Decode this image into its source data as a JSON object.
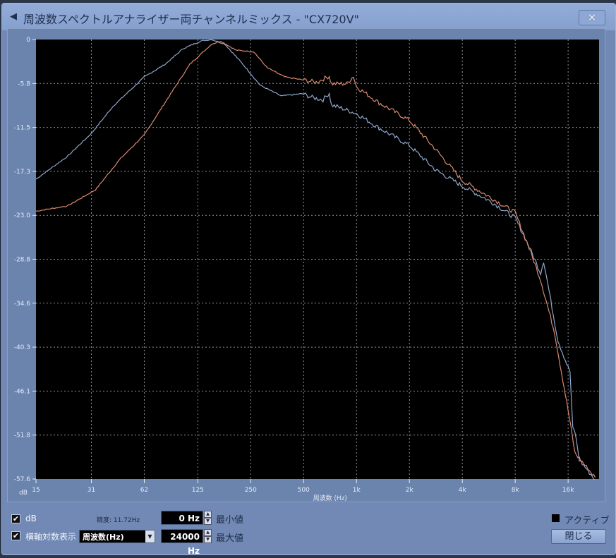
{
  "window": {
    "title": "周波数スペクトルアナライザー両チャンネルミックス - \"CX720V\"",
    "close_icon": "close-icon",
    "app_icon": "cubase-icon"
  },
  "chart_data": {
    "type": "line",
    "title": "",
    "xlabel": "周波数 (Hz)",
    "ylabel": "dB",
    "xscale": "log",
    "xlim": [
      15,
      24000
    ],
    "ylim": [
      -57.6,
      0
    ],
    "xticks": [
      {
        "v": 15,
        "label": "15"
      },
      {
        "v": 31,
        "label": "31"
      },
      {
        "v": 62,
        "label": "62"
      },
      {
        "v": 125,
        "label": "125"
      },
      {
        "v": 250,
        "label": "250"
      },
      {
        "v": 500,
        "label": "500"
      },
      {
        "v": 1000,
        "label": "1k"
      },
      {
        "v": 2000,
        "label": "2k"
      },
      {
        "v": 4000,
        "label": "4k"
      },
      {
        "v": 8000,
        "label": "8k"
      },
      {
        "v": 16000,
        "label": "16k"
      }
    ],
    "yticks": [
      {
        "v": 0,
        "label": "0"
      },
      {
        "v": -5.76,
        "label": "-5.8"
      },
      {
        "v": -11.52,
        "label": "-11.5"
      },
      {
        "v": -17.28,
        "label": "-17.3"
      },
      {
        "v": -23.04,
        "label": "-23.0"
      },
      {
        "v": -28.8,
        "label": "-28.8"
      },
      {
        "v": -34.56,
        "label": "-34.6"
      },
      {
        "v": -40.32,
        "label": "-40.3"
      },
      {
        "v": -46.08,
        "label": "-46.1"
      },
      {
        "v": -51.84,
        "label": "-51.8"
      },
      {
        "v": -57.6,
        "label": "-57.6"
      }
    ],
    "grid": true,
    "series": [
      {
        "name": "blue",
        "color": "#8fa6cc",
        "points": [
          [
            15,
            -18.3
          ],
          [
            22.7,
            -15.3
          ],
          [
            31,
            -12.3
          ],
          [
            41,
            -8.8
          ],
          [
            62,
            -4.9
          ],
          [
            82,
            -3.2
          ],
          [
            103,
            -1.2
          ],
          [
            130,
            -0.2
          ],
          [
            150,
            0
          ],
          [
            178,
            -0.6
          ],
          [
            225,
            -3.2
          ],
          [
            283,
            -6.0
          ],
          [
            373,
            -7.4
          ],
          [
            491,
            -7.1
          ],
          [
            560,
            -7.6
          ],
          [
            645,
            -7.9
          ],
          [
            700,
            -7.0
          ],
          [
            720,
            -8.6
          ],
          [
            775,
            -8.8
          ],
          [
            1000,
            -9.7
          ],
          [
            1345,
            -11.6
          ],
          [
            2000,
            -13.9
          ],
          [
            2820,
            -17.1
          ],
          [
            4000,
            -19.2
          ],
          [
            5880,
            -21.3
          ],
          [
            8000,
            -23.4
          ],
          [
            9280,
            -26.4
          ],
          [
            11160,
            -30.6
          ],
          [
            11600,
            -29.0
          ],
          [
            12230,
            -31.9
          ],
          [
            14000,
            -39.4
          ],
          [
            16000,
            -43.0
          ],
          [
            16400,
            -43.5
          ],
          [
            17000,
            -51.0
          ],
          [
            17500,
            -51.4
          ],
          [
            18550,
            -55.1
          ],
          [
            22800,
            -57.7
          ]
        ]
      },
      {
        "name": "orange",
        "color": "#d98a6e",
        "points": [
          [
            15,
            -22.5
          ],
          [
            22.7,
            -21.8
          ],
          [
            32.7,
            -19.7
          ],
          [
            45,
            -15.7
          ],
          [
            62,
            -12.5
          ],
          [
            86,
            -7.4
          ],
          [
            113,
            -3.2
          ],
          [
            150,
            -0.6
          ],
          [
            169,
            -0.2
          ],
          [
            206,
            -1.4
          ],
          [
            260,
            -1.6
          ],
          [
            310,
            -3.7
          ],
          [
            390,
            -4.9
          ],
          [
            590,
            -5.6
          ],
          [
            700,
            -4.8
          ],
          [
            720,
            -5.8
          ],
          [
            880,
            -5.8
          ],
          [
            960,
            -4.8
          ],
          [
            1000,
            -6.2
          ],
          [
            1345,
            -8.3
          ],
          [
            2000,
            -10.6
          ],
          [
            2820,
            -14.4
          ],
          [
            4000,
            -18.5
          ],
          [
            5880,
            -20.8
          ],
          [
            8000,
            -22.7
          ],
          [
            9280,
            -26.4
          ],
          [
            11160,
            -31.5
          ],
          [
            13400,
            -38.4
          ],
          [
            16000,
            -48.6
          ],
          [
            17500,
            -54.2
          ],
          [
            22800,
            -57.4
          ]
        ]
      }
    ]
  },
  "controls": {
    "db_label": "dB",
    "db_checked": true,
    "log_label": "横軸対数表示",
    "log_checked": true,
    "resolution": "精度: 11.72Hz",
    "unit_select": "周波数(Hz)",
    "min_value": "0 Hz",
    "min_label": "最小値",
    "max_value": "24000 Hz",
    "max_label": "最大値",
    "active_label": "アクティブ",
    "close_button": "閉じる"
  }
}
